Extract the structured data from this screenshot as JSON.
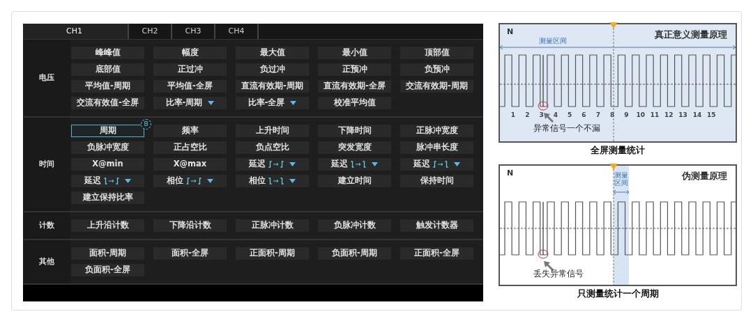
{
  "tabs": [
    {
      "label": "CH1",
      "selected": true
    },
    {
      "label": "CH2",
      "selected": false
    },
    {
      "label": "CH3",
      "selected": false
    },
    {
      "label": "CH4",
      "selected": false
    }
  ],
  "sections": [
    {
      "label": "电压",
      "items": [
        {
          "label": "峰峰值",
          "selected": false,
          "dropdown": false
        },
        {
          "label": "幅度",
          "selected": false,
          "dropdown": false
        },
        {
          "label": "最大值",
          "selected": false,
          "dropdown": false
        },
        {
          "label": "最小值",
          "selected": false,
          "dropdown": false
        },
        {
          "label": "顶部值",
          "selected": false,
          "dropdown": false
        },
        {
          "label": "底部值",
          "selected": false,
          "dropdown": false
        },
        {
          "label": "正过冲",
          "selected": false,
          "dropdown": false
        },
        {
          "label": "负过冲",
          "selected": false,
          "dropdown": false
        },
        {
          "label": "正预冲",
          "selected": false,
          "dropdown": false
        },
        {
          "label": "负预冲",
          "selected": false,
          "dropdown": false
        },
        {
          "label": "平均值-周期",
          "selected": false,
          "dropdown": false
        },
        {
          "label": "平均值-全屏",
          "selected": false,
          "dropdown": false
        },
        {
          "label": "直流有效期-周期",
          "selected": false,
          "dropdown": false
        },
        {
          "label": "直流有效期-全屏",
          "selected": false,
          "dropdown": false
        },
        {
          "label": "交流有效期-周期",
          "selected": false,
          "dropdown": false
        },
        {
          "label": "交流有效值-全屏",
          "selected": false,
          "dropdown": false
        },
        {
          "label": "比率-周期",
          "selected": false,
          "dropdown": true
        },
        {
          "label": "比率-全屏",
          "selected": false,
          "dropdown": true
        },
        {
          "label": "校准平均值",
          "selected": false,
          "dropdown": false
        }
      ]
    },
    {
      "label": "时间",
      "items": [
        {
          "label": "周期",
          "selected": true,
          "dropdown": false,
          "badge": "B"
        },
        {
          "label": "频率",
          "selected": false,
          "dropdown": false
        },
        {
          "label": "上升时间",
          "selected": false,
          "dropdown": false
        },
        {
          "label": "下降时间",
          "selected": false,
          "dropdown": false
        },
        {
          "label": "正脉冲宽度",
          "selected": false,
          "dropdown": false
        },
        {
          "label": "负脉冲宽度",
          "selected": false,
          "dropdown": false
        },
        {
          "label": "正占空比",
          "selected": false,
          "dropdown": false
        },
        {
          "label": "负点空比",
          "selected": false,
          "dropdown": false
        },
        {
          "label": "突发宽度",
          "selected": false,
          "dropdown": false
        },
        {
          "label": "脉冲串长度",
          "selected": false,
          "dropdown": false
        },
        {
          "label": "X@min",
          "selected": false,
          "dropdown": false
        },
        {
          "label": "X@max",
          "selected": false,
          "dropdown": false
        },
        {
          "label": "延迟",
          "selected": false,
          "dropdown": true,
          "edges": [
            {
              "kind": "rise"
            },
            {
              "kind": "rise"
            }
          ]
        },
        {
          "label": "延迟",
          "selected": false,
          "dropdown": true,
          "edges": [
            {
              "kind": "fall"
            },
            {
              "kind": "fall"
            }
          ]
        },
        {
          "label": "延迟",
          "selected": false,
          "dropdown": true,
          "edges": [
            {
              "kind": "rise"
            },
            {
              "kind": "fall"
            }
          ]
        },
        {
          "label": "延迟",
          "selected": false,
          "dropdown": true,
          "edges": [
            {
              "kind": "fall"
            },
            {
              "kind": "rise"
            }
          ]
        },
        {
          "label": "相位",
          "selected": false,
          "dropdown": true,
          "edges": [
            {
              "kind": "rise"
            },
            {
              "kind": "rise"
            }
          ]
        },
        {
          "label": "相位",
          "selected": false,
          "dropdown": true,
          "edges": [
            {
              "kind": "fall"
            },
            {
              "kind": "fall"
            }
          ]
        },
        {
          "label": "建立时间",
          "selected": false,
          "dropdown": false
        },
        {
          "label": "保持时间",
          "selected": false,
          "dropdown": false
        },
        {
          "label": "建立保持比率",
          "selected": false,
          "dropdown": false
        }
      ]
    },
    {
      "label": "计数",
      "items": [
        {
          "label": "上升沿计数",
          "selected": false,
          "dropdown": false
        },
        {
          "label": "下降沿计数",
          "selected": false,
          "dropdown": false
        },
        {
          "label": "正脉冲计数",
          "selected": false,
          "dropdown": false
        },
        {
          "label": "负脉冲计数",
          "selected": false,
          "dropdown": false
        },
        {
          "label": "触发计数器",
          "selected": false,
          "dropdown": false
        }
      ]
    },
    {
      "label": "其他",
      "items": [
        {
          "label": "面积-周期",
          "selected": false,
          "dropdown": false
        },
        {
          "label": "面积-全屏",
          "selected": false,
          "dropdown": false
        },
        {
          "label": "正面积-周期",
          "selected": false,
          "dropdown": false
        },
        {
          "label": "负面积-周期",
          "selected": false,
          "dropdown": false
        },
        {
          "label": "正面积-全屏",
          "selected": false,
          "dropdown": false
        },
        {
          "label": "负面积-全屏",
          "selected": false,
          "dropdown": false
        }
      ]
    }
  ],
  "diagrams": [
    {
      "kind": "full",
      "corner": "N",
      "title": "真正意义测量原理",
      "range_label": "测量区间",
      "ticks": [
        "1",
        "2",
        "3",
        "4",
        "5",
        "6",
        "7",
        "8",
        "9",
        "10",
        "11",
        "12",
        "13",
        "14",
        "15"
      ],
      "annotation": "异常信号一个不漏",
      "caption": "全屏测量统计"
    },
    {
      "kind": "single",
      "corner": "N",
      "title": "伪测量原理",
      "range_label": "测量区间",
      "annotation": "丢失异常信号",
      "caption": "只测量统计一个周期"
    }
  ]
}
